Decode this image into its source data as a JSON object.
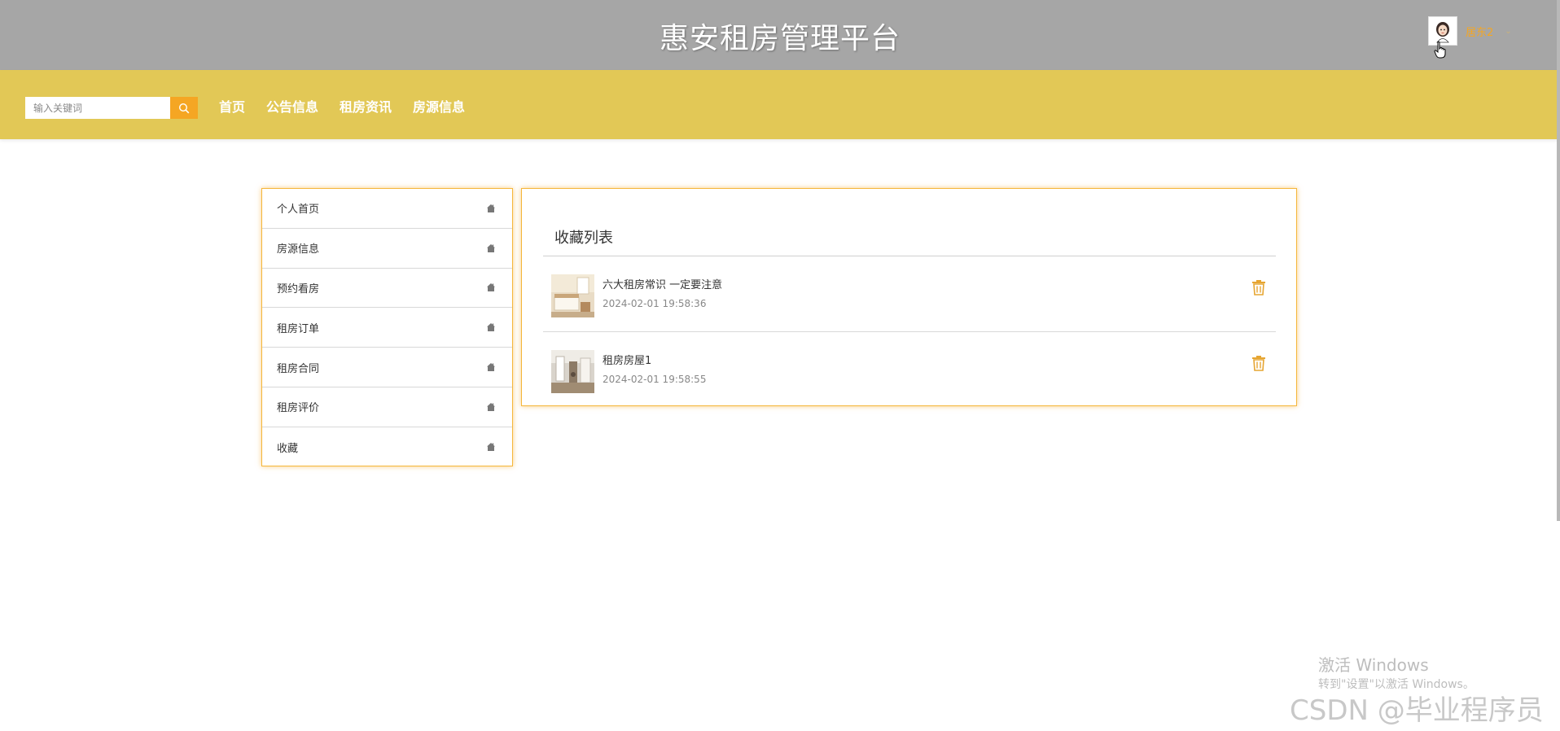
{
  "header": {
    "site_title": "惠安租房管理平台",
    "user": {
      "name": "居东2",
      "caret": "⌄",
      "avatar_icon": "user-avatar-icon"
    }
  },
  "nav": {
    "search": {
      "placeholder": "输入关键词",
      "value": "",
      "icon": "search-icon"
    },
    "links": [
      "首页",
      "公告信息",
      "租房资讯",
      "房源信息"
    ]
  },
  "sidebar": {
    "items": [
      {
        "label": "个人首页",
        "icon": "home-icon"
      },
      {
        "label": "房源信息",
        "icon": "home-icon"
      },
      {
        "label": "预约看房",
        "icon": "home-icon"
      },
      {
        "label": "租房订单",
        "icon": "home-icon"
      },
      {
        "label": "租房合同",
        "icon": "home-icon"
      },
      {
        "label": "租房评价",
        "icon": "home-icon"
      },
      {
        "label": "收藏",
        "icon": "home-icon"
      }
    ]
  },
  "favorites": {
    "title": "收藏列表",
    "items": [
      {
        "name": "六大租房常识 一定要注意",
        "time": "2024-02-01 19:58:36",
        "action_icon": "trash-icon"
      },
      {
        "name": "租房房屋1",
        "time": "2024-02-01 19:58:55",
        "action_icon": "trash-icon"
      }
    ]
  },
  "watermarks": {
    "windows_title": "激活 Windows",
    "windows_sub": "转到\"设置\"以激活 Windows。",
    "csdn": "CSDN @毕业程序员"
  },
  "colors": {
    "top_bar": "#a6a6a6",
    "nav_bar": "#e2c856",
    "accent": "#f5a623",
    "panel_border": "#f5b63a"
  }
}
